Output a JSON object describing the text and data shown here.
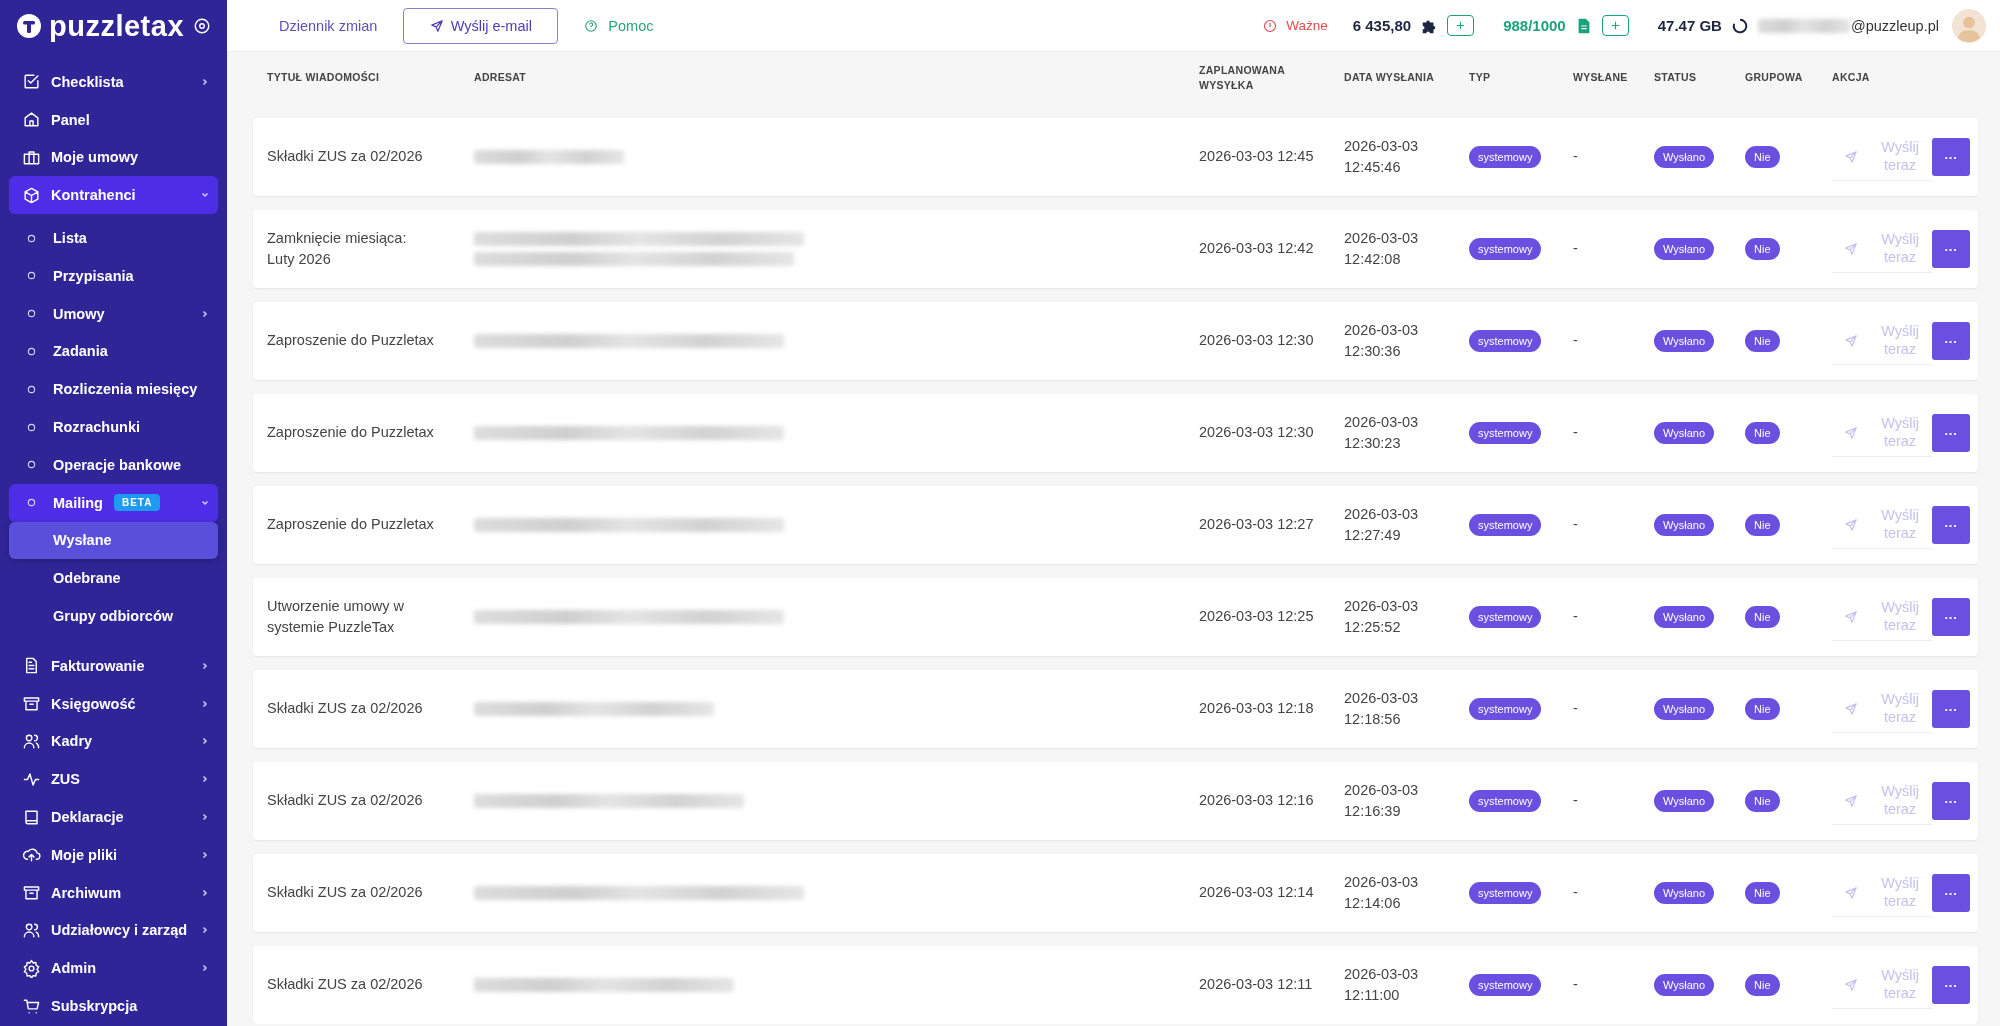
{
  "sidebar": {
    "logo": "puzzletax",
    "items": [
      {
        "label": "Checklista",
        "kind": "group",
        "expanded": false,
        "selected": false
      },
      {
        "label": "Panel",
        "kind": "link",
        "selected": false
      },
      {
        "label": "Moje umowy",
        "kind": "link",
        "selected": false
      },
      {
        "label": "Kontrahenci",
        "kind": "group",
        "expanded": true,
        "selected": false,
        "children": [
          {
            "label": "Lista",
            "kind": "link",
            "selected": false
          },
          {
            "label": "Przypisania",
            "kind": "link",
            "selected": false
          },
          {
            "label": "Umowy",
            "kind": "group",
            "expanded": false,
            "selected": false
          },
          {
            "label": "Zadania",
            "kind": "link",
            "selected": false
          },
          {
            "label": "Rozliczenia miesięcy",
            "kind": "link",
            "selected": false
          },
          {
            "label": "Rozrachunki",
            "kind": "link",
            "selected": false
          },
          {
            "label": "Operacje bankowe",
            "kind": "link",
            "selected": false
          },
          {
            "label": "Mailing",
            "badge": "BETA",
            "kind": "group",
            "expanded": true,
            "selected": false,
            "children": [
              {
                "label": "Wysłane",
                "selected": true
              },
              {
                "label": "Odebrane",
                "selected": false
              },
              {
                "label": "Grupy odbiorców",
                "selected": false
              }
            ]
          }
        ]
      },
      {
        "label": "Fakturowanie",
        "kind": "group",
        "expanded": false,
        "selected": false
      },
      {
        "label": "Księgowość",
        "kind": "group",
        "expanded": false,
        "selected": false
      },
      {
        "label": "Kadry",
        "kind": "group",
        "expanded": false,
        "selected": false
      },
      {
        "label": "ZUS",
        "kind": "group",
        "expanded": false,
        "selected": false
      },
      {
        "label": "Deklaracje",
        "kind": "group",
        "expanded": false,
        "selected": false
      },
      {
        "label": "Moje pliki",
        "kind": "group",
        "expanded": false,
        "selected": false
      },
      {
        "label": "Archiwum",
        "kind": "group",
        "expanded": false,
        "selected": false
      },
      {
        "label": "Udziałowcy i zarząd",
        "kind": "group",
        "expanded": false,
        "selected": false
      },
      {
        "label": "Admin",
        "kind": "group",
        "expanded": false,
        "selected": false
      },
      {
        "label": "Subskrypcja",
        "kind": "link",
        "selected": false
      }
    ]
  },
  "top_bar": {
    "changelog": "Dziennik zmian",
    "send_email": "Wyślij e-mail",
    "help": "Pomoc",
    "alert": "Ważne",
    "points": "6 435,80",
    "documents": "988/1000",
    "storage": "47.47 GB",
    "user_email": "@puzzleup.pl"
  },
  "table": {
    "columns": [
      "TYTUŁ WIADOMOŚCI",
      "ADRESAT",
      "ZAPLANOWANA WYSYŁKA",
      "DATA WYSŁANIA",
      "TYP",
      "WYSŁANE",
      "STATUS",
      "GRUPOWA",
      "AKCJA"
    ],
    "rows": [
      {
        "title": "Składki ZUS za 02/2026",
        "scheduled": "2026-03-03 12:45",
        "sent_at": "2026-03-03 12:45:46",
        "type": "systemowy",
        "sent": "-",
        "status": "Wysłano",
        "group": "Nie",
        "action": {
          "label": "Wyślij teraz",
          "disabled": true
        },
        "more": "···"
      },
      {
        "title": "Zamknięcie miesiąca: Luty 2026",
        "scheduled": "2026-03-03 12:42",
        "sent_at": "2026-03-03 12:42:08",
        "type": "systemowy",
        "sent": "-",
        "status": "Wysłano",
        "group": "Nie",
        "action": {
          "label": "Wyślij teraz",
          "disabled": true
        },
        "more": "···"
      },
      {
        "title": "Zaproszenie do Puzzletax",
        "scheduled": "2026-03-03 12:30",
        "sent_at": "2026-03-03 12:30:36",
        "type": "systemowy",
        "sent": "-",
        "status": "Wysłano",
        "group": "Nie",
        "action": {
          "label": "Wyślij teraz",
          "disabled": true
        },
        "more": "···"
      },
      {
        "title": "Zaproszenie do Puzzletax",
        "scheduled": "2026-03-03 12:30",
        "sent_at": "2026-03-03 12:30:23",
        "type": "systemowy",
        "sent": "-",
        "status": "Wysłano",
        "group": "Nie",
        "action": {
          "label": "Wyślij teraz",
          "disabled": true
        },
        "more": "···"
      },
      {
        "title": "Zaproszenie do Puzzletax",
        "scheduled": "2026-03-03 12:27",
        "sent_at": "2026-03-03 12:27:49",
        "type": "systemowy",
        "sent": "-",
        "status": "Wysłano",
        "group": "Nie",
        "action": {
          "label": "Wyślij teraz",
          "disabled": true
        },
        "more": "···"
      },
      {
        "title": "Utworzenie umowy w systemie PuzzleTax",
        "scheduled": "2026-03-03 12:25",
        "sent_at": "2026-03-03 12:25:52",
        "type": "systemowy",
        "sent": "-",
        "status": "Wysłano",
        "group": "Nie",
        "action": {
          "label": "Wyślij teraz",
          "disabled": true
        },
        "more": "···"
      },
      {
        "title": "Składki ZUS za 02/2026",
        "scheduled": "2026-03-03 12:18",
        "sent_at": "2026-03-03 12:18:56",
        "type": "systemowy",
        "sent": "-",
        "status": "Wysłano",
        "group": "Nie",
        "action": {
          "label": "Wyślij teraz",
          "disabled": true
        },
        "more": "···"
      },
      {
        "title": "Składki ZUS za 02/2026",
        "scheduled": "2026-03-03 12:16",
        "sent_at": "2026-03-03 12:16:39",
        "type": "systemowy",
        "sent": "-",
        "status": "Wysłano",
        "group": "Nie",
        "action": {
          "label": "Wyślij teraz",
          "disabled": true
        },
        "more": "···"
      },
      {
        "title": "Składki ZUS za 02/2026",
        "scheduled": "2026-03-03 12:14",
        "sent_at": "2026-03-03 12:14:06",
        "type": "systemowy",
        "sent": "-",
        "status": "Wysłano",
        "group": "Nie",
        "action": {
          "label": "Wyślij teraz",
          "disabled": true
        },
        "more": "···"
      },
      {
        "title": "Składki ZUS za 02/2026",
        "scheduled": "2026-03-03 12:11",
        "sent_at": "2026-03-03 12:11:00",
        "type": "systemowy",
        "sent": "-",
        "status": "Wysłano",
        "group": "Nie",
        "action": {
          "label": "Wyślij teraz",
          "disabled": true
        },
        "more": "···"
      }
    ]
  }
}
